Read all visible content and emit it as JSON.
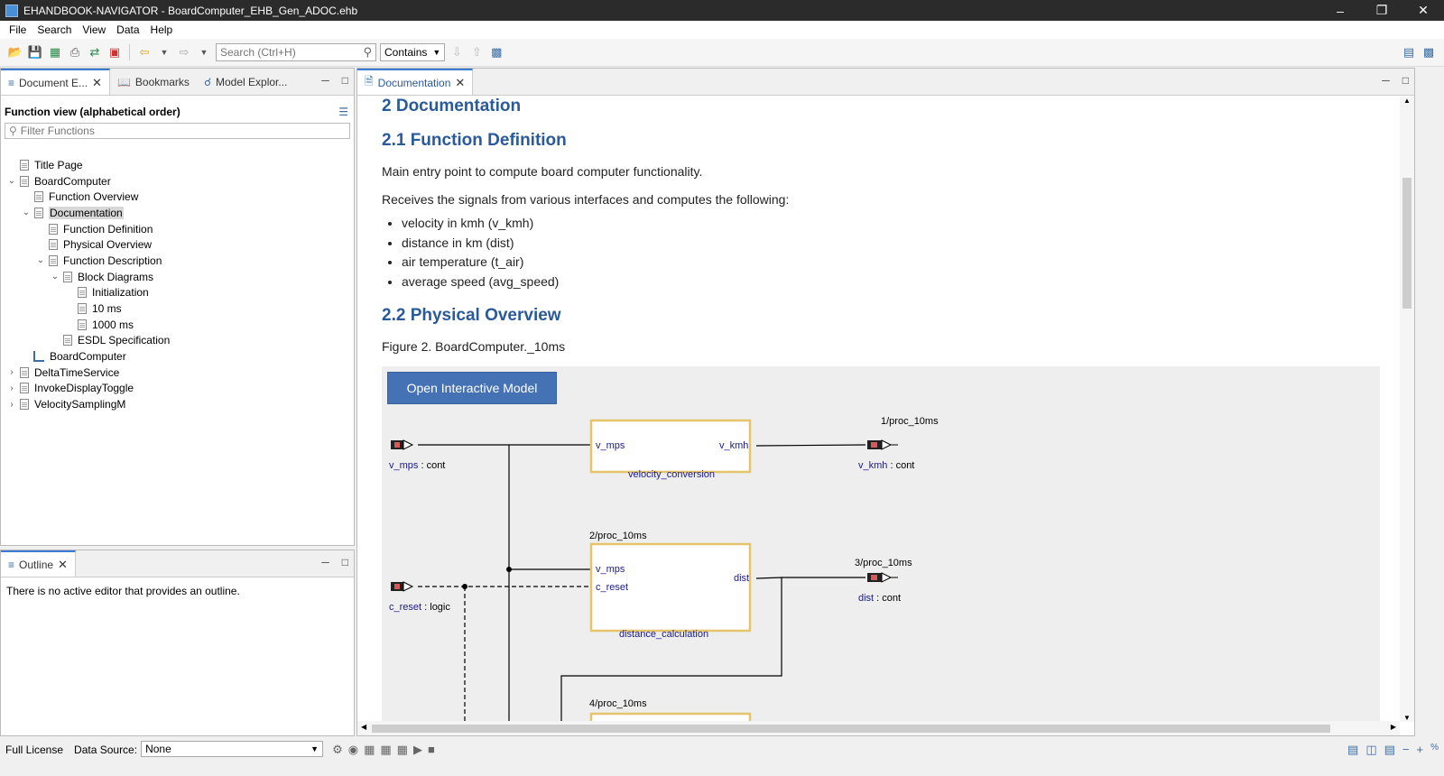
{
  "window": {
    "title": "EHANDBOOK-NAVIGATOR - BoardComputer_EHB_Gen_ADOC.ehb"
  },
  "menu": {
    "items": [
      "File",
      "Search",
      "View",
      "Data",
      "Help"
    ]
  },
  "toolbar": {
    "search_placeholder": "Search (Ctrl+H)",
    "search_mode": "Contains"
  },
  "left": {
    "tabs": [
      {
        "label": "Document E..."
      },
      {
        "label": "Bookmarks"
      },
      {
        "label": "Model Explor..."
      }
    ],
    "view_title": "Function view (alphabetical order)",
    "filter_placeholder": "Filter Functions",
    "tree": [
      {
        "label": "Title Page"
      },
      {
        "label": "BoardComputer"
      },
      {
        "label": "Function Overview"
      },
      {
        "label": "Documentation"
      },
      {
        "label": "Function Definition"
      },
      {
        "label": "Physical Overview"
      },
      {
        "label": "Function Description"
      },
      {
        "label": "Block Diagrams"
      },
      {
        "label": "Initialization"
      },
      {
        "label": "10 ms"
      },
      {
        "label": "1000 ms"
      },
      {
        "label": "ESDL Specification"
      },
      {
        "label": "BoardComputer"
      },
      {
        "label": "DeltaTimeService"
      },
      {
        "label": "InvokeDisplayToggle"
      },
      {
        "label": "VelocitySamplingM"
      }
    ]
  },
  "outline": {
    "tab": "Outline",
    "message": "There is no active editor that provides an outline."
  },
  "doc": {
    "tab": "Documentation",
    "h_doc": "2 Documentation",
    "h_def": "2.1 Function Definition",
    "p1": "Main entry point to compute board computer functionality.",
    "p2": "Receives the signals from various interfaces and computes the following:",
    "bullets": [
      "velocity in kmh (v_kmh)",
      "distance in km (dist)",
      "air temperature (t_air)",
      "average speed (avg_speed)"
    ],
    "h_phys": "2.2 Physical Overview",
    "figure_caption": "Figure 2. BoardComputer._10ms",
    "open_model": "Open Interactive Model"
  },
  "diagram": {
    "in_v_mps": "v_mps",
    "in_v_mps_type": " : cont",
    "in_c_reset": "c_reset",
    "in_c_reset_type": " : logic",
    "block1": "velocity_conversion",
    "block1_in": "v_mps",
    "block1_out": "v_kmh",
    "block2": "distance_calculation",
    "block2_in1": "v_mps",
    "block2_in2": "c_reset",
    "block2_out": "dist",
    "out1_name": "v_kmh",
    "out1_type": " : cont",
    "out1_proc": "1/proc_10ms",
    "out2_name": "dist",
    "out2_type": " : cont",
    "out2_proc": "3/proc_10ms",
    "proc2": "2/proc_10ms",
    "proc4": "4/proc_10ms"
  },
  "status": {
    "license": "Full License",
    "data_source_label": "Data Source:",
    "data_source_value": "None"
  }
}
